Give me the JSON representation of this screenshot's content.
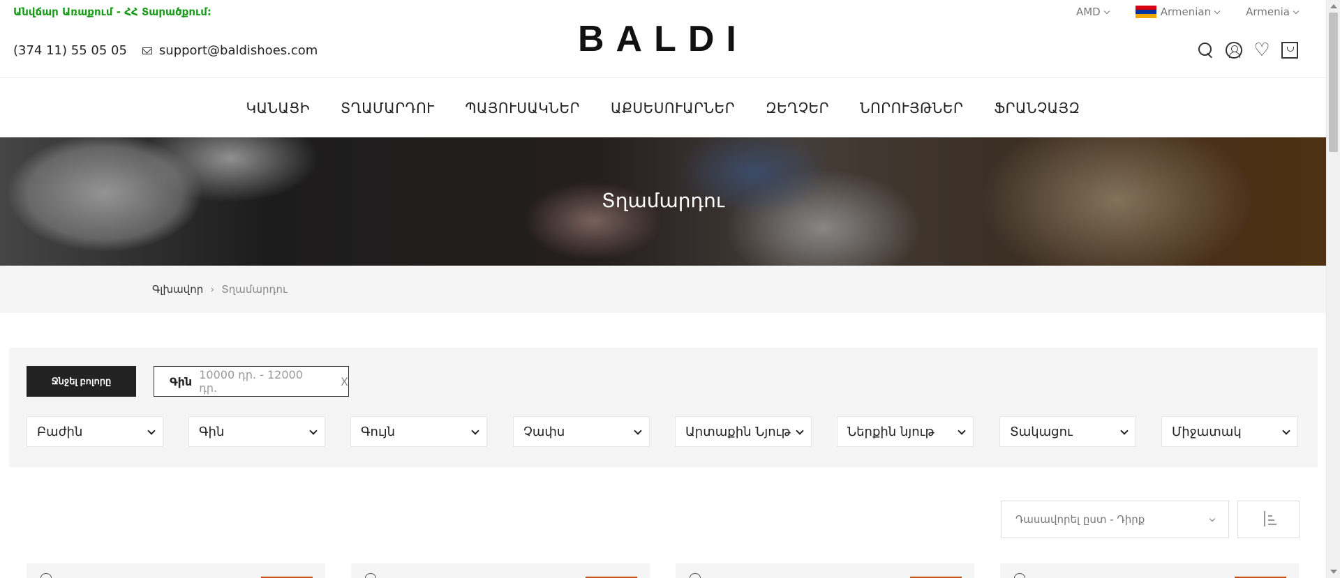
{
  "topbar": {
    "promo": "Անվճար Առաքում - ՀՀ Տարածքում:",
    "phone": "(374 11) 55 05 05",
    "email": "support@baldishoes.com",
    "logo": "BALDI",
    "currency": "AMD",
    "language": "Armenian",
    "country": "Armenia"
  },
  "nav": {
    "items": [
      "ԿԱՆԱՑԻ",
      "ՏՂԱՄԱՐԴՈՒ",
      "ՊԱՅՈՒՍԱԿՆԵՐ",
      "ԱՔՍԵՍՈՒԱՐՆԵՐ",
      "ԶԵՂՉԵՐ",
      "ՆՈՐՈՒՅԹՆԵՐ",
      "ՖՐԱՆՉԱՅԶ"
    ]
  },
  "hero": {
    "title": "Տղամարդու"
  },
  "breadcrumb": {
    "home": "Գլխավոր",
    "separator": "›",
    "current": "Տղամարդու"
  },
  "filters": {
    "clear_label": "Ջնջել բոլորը",
    "active_chip": {
      "key": "Գին",
      "value": "10000 դր. - 12000 դր.",
      "remove": "X"
    },
    "selects": [
      "Բաժին",
      "Գին",
      "Գույն",
      "Չափս",
      "Արտաքին Նյութ",
      "Ներքին նյութ",
      "Տակացու",
      "Միջատակ"
    ]
  },
  "sort": {
    "label": "Դասավորել ըստ - Դիրք"
  },
  "colors": {
    "promo": "#1a9a1a",
    "badge": "#c8511b",
    "clear_button": "#222222"
  }
}
